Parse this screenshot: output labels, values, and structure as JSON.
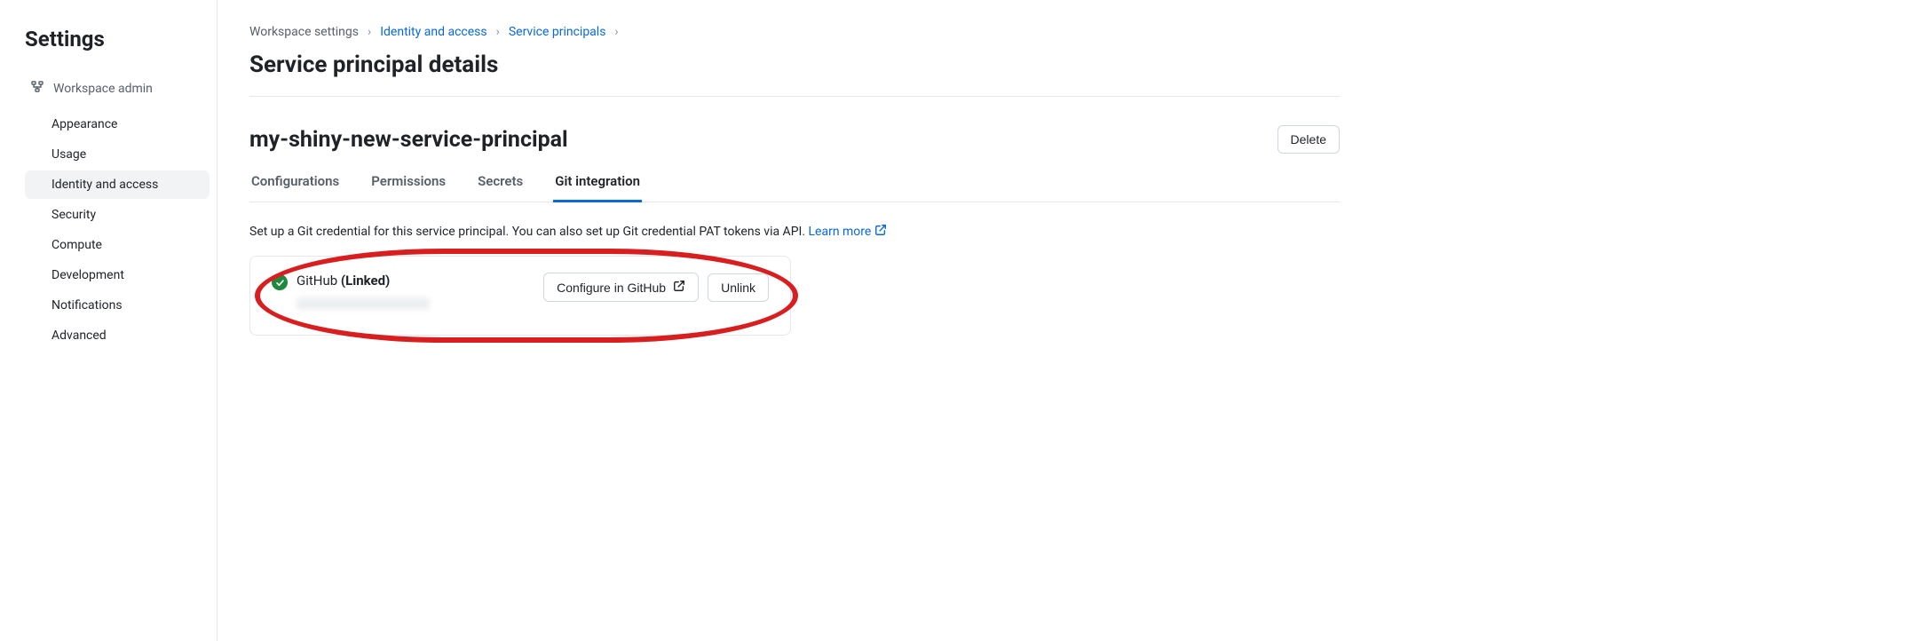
{
  "sidebar": {
    "title": "Settings",
    "section_header": "Workspace admin",
    "items": [
      {
        "label": "Appearance",
        "active": false
      },
      {
        "label": "Usage",
        "active": false
      },
      {
        "label": "Identity and access",
        "active": true
      },
      {
        "label": "Security",
        "active": false
      },
      {
        "label": "Compute",
        "active": false
      },
      {
        "label": "Development",
        "active": false
      },
      {
        "label": "Notifications",
        "active": false
      },
      {
        "label": "Advanced",
        "active": false
      }
    ]
  },
  "breadcrumb": {
    "items": [
      {
        "label": "Workspace settings",
        "link": false
      },
      {
        "label": "Identity and access",
        "link": true
      },
      {
        "label": "Service principals",
        "link": true
      }
    ],
    "separator": "›"
  },
  "page": {
    "title": "Service principal details",
    "resource_name": "my-shiny-new-service-principal",
    "delete_label": "Delete"
  },
  "tabs": [
    {
      "label": "Configurations",
      "active": false
    },
    {
      "label": "Permissions",
      "active": false
    },
    {
      "label": "Secrets",
      "active": false
    },
    {
      "label": "Git integration",
      "active": true
    }
  ],
  "description": {
    "text": "Set up a Git credential for this service principal. You can also set up Git credential PAT tokens via API. ",
    "learn_more": "Learn more"
  },
  "git_card": {
    "provider": "GitHub",
    "status": "(Linked)",
    "configure_label": "Configure in GitHub",
    "unlink_label": "Unlink"
  }
}
